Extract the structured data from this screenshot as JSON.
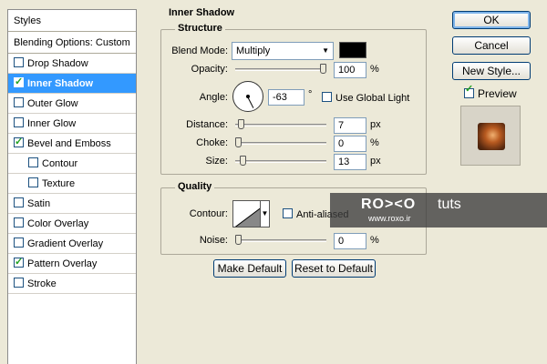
{
  "styles_list": {
    "header": "Styles",
    "blending": "Blending Options: Custom",
    "items": [
      {
        "label": "Drop Shadow",
        "checked": false
      },
      {
        "label": "Inner Shadow",
        "checked": true,
        "selected": true
      },
      {
        "label": "Outer Glow",
        "checked": false
      },
      {
        "label": "Inner Glow",
        "checked": false
      },
      {
        "label": "Bevel and Emboss",
        "checked": true
      },
      {
        "label": "Contour",
        "checked": false,
        "sub": true
      },
      {
        "label": "Texture",
        "checked": false,
        "sub": true
      },
      {
        "label": "Satin",
        "checked": false
      },
      {
        "label": "Color Overlay",
        "checked": false
      },
      {
        "label": "Gradient Overlay",
        "checked": false
      },
      {
        "label": "Pattern Overlay",
        "checked": true
      },
      {
        "label": "Stroke",
        "checked": false
      }
    ]
  },
  "panel": {
    "title": "Inner Shadow",
    "structure": {
      "legend": "Structure",
      "blend_mode_label": "Blend Mode:",
      "blend_mode_value": "Multiply",
      "blend_color": "#000000",
      "opacity_label": "Opacity:",
      "opacity_value": "100",
      "opacity_unit": "%",
      "opacity_level": 1.0,
      "angle_label": "Angle:",
      "angle_value": "-63",
      "angle_unit": "°",
      "use_global_light_label": "Use Global Light",
      "use_global_light": false,
      "distance_label": "Distance:",
      "distance_value": "7",
      "distance_unit": "px",
      "distance_level": 0.03,
      "choke_label": "Choke:",
      "choke_value": "0",
      "choke_unit": "%",
      "choke_level": 0.0,
      "size_label": "Size:",
      "size_value": "13",
      "size_unit": "px",
      "size_level": 0.05
    },
    "quality": {
      "legend": "Quality",
      "contour_label": "Contour:",
      "anti_aliased_label": "Anti-aliased",
      "anti_aliased": false,
      "noise_label": "Noise:",
      "noise_value": "0",
      "noise_unit": "%",
      "noise_level": 0.0
    },
    "make_default": "Make Default",
    "reset_to_default": "Reset to Default"
  },
  "buttons": {
    "ok": "OK",
    "cancel": "Cancel",
    "new_style": "New Style...",
    "preview_label": "Preview",
    "preview_checked": true
  },
  "watermark": {
    "logo": "RO><O",
    "tuts": "tuts",
    "url": "www.roxo.ir"
  },
  "colors": {
    "selection": "#3399ff",
    "dialog_bg": "#ece9d8"
  }
}
